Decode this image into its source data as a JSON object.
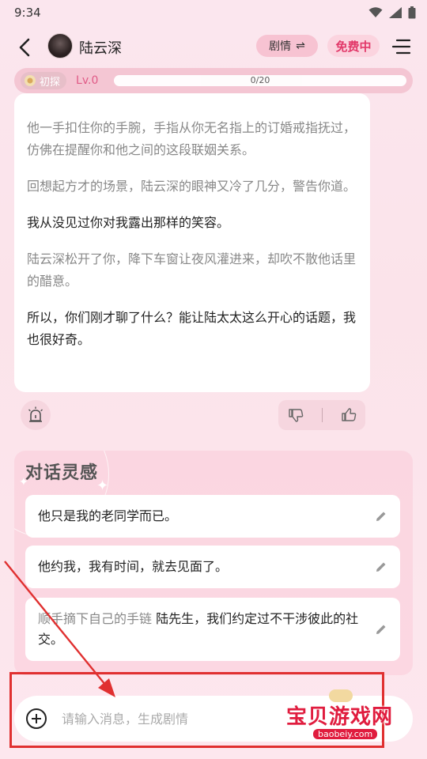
{
  "status_bar": {
    "time": "9:34"
  },
  "header": {
    "character_name": "陆云深",
    "plot_label": "剧情",
    "plot_icon": "⇌",
    "free_label": "免费中"
  },
  "level": {
    "badge_label": "初探",
    "level_label": "Lv.0",
    "progress_text": "0/20",
    "progress_fraction": 0
  },
  "message": {
    "paragraphs": [
      "他一手扣住你的手腕，手指从你无名指上的订婚戒指抚过，仿佛在提醒你和他之间的这段联姻关系。",
      "回想起方才的场景，陆云深的眼神又冷了几分，警告你道。",
      "我从没见过你对我露出那样的笑容。",
      "陆云深松开了你，降下车窗让夜风灌进来，却吹不散他话里的醋意。",
      "所以，你们刚才聊了什么？能让陆太太这么开心的话题，我也很好奇。"
    ]
  },
  "inspiration": {
    "title": "对话灵感",
    "suggestions": [
      {
        "text": "他只是我的老同学而已。"
      },
      {
        "text": "他约我，我有时间，就去见面了。"
      },
      {
        "action": "顺手摘下自己的手链",
        "text": "陆先生，我们约定过不干涉彼此的社交。"
      }
    ]
  },
  "input": {
    "placeholder": "请输入消息，生成剧情"
  },
  "watermark": {
    "brand": "宝贝游戏网",
    "url": "baobeiy.com"
  },
  "colors": {
    "accent": "#e2396a",
    "annotation": "#e03030",
    "progress": "#f590ae"
  }
}
